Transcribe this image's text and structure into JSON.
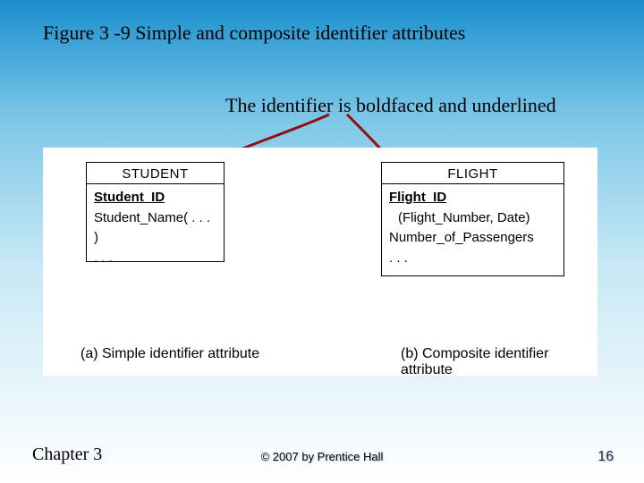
{
  "figure": {
    "title": "Figure 3 -9 Simple and composite identifier attributes",
    "annotation": "The identifier is boldfaced and underlined"
  },
  "diagram": {
    "student": {
      "name": "STUDENT",
      "identifier": "Student_ID",
      "attr_composite": "Student_Name( . . . )",
      "ellipsis": ". . ."
    },
    "flight": {
      "name": "FLIGHT",
      "identifier": "Flight_ID",
      "identifier_components": "(Flight_Number, Date)",
      "attr_count": "Number_of_Passengers",
      "ellipsis": ". . ."
    },
    "caption_a": "(a) Simple identifier attribute",
    "caption_b": "(b) Composite identifier attribute"
  },
  "footer": {
    "chapter": "Chapter 3",
    "copyright": "© 2007 by Prentice Hall",
    "page": "16"
  }
}
